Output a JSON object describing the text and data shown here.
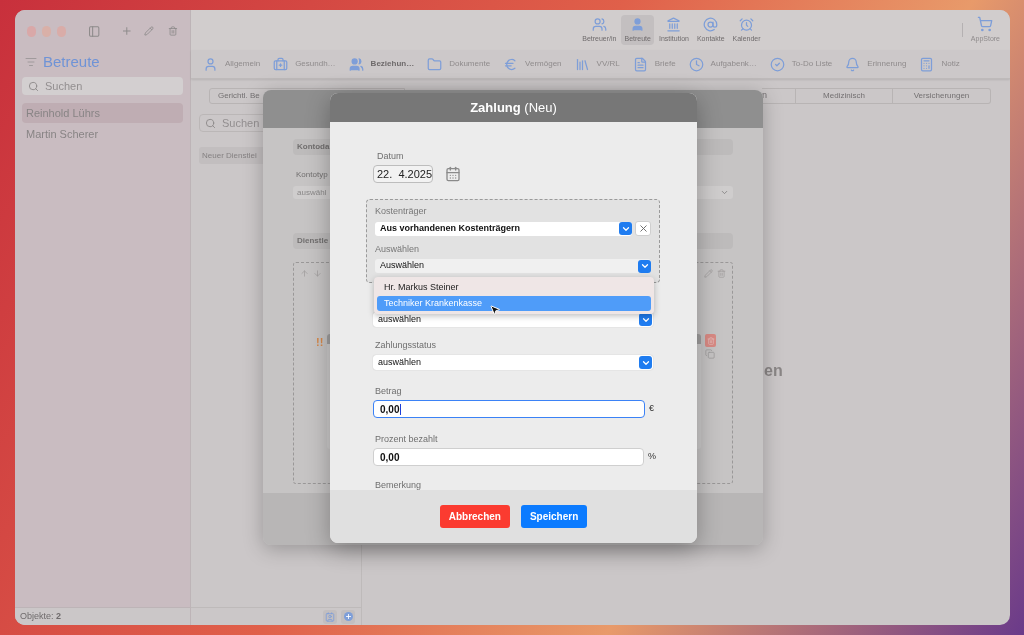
{
  "sidebar": {
    "title": "Betreute",
    "search": {
      "placeholder": "Suchen"
    },
    "items": [
      {
        "label": "Reinhold Lührs",
        "selected": true
      },
      {
        "label": "Martin Scherer",
        "selected": false
      }
    ],
    "status": {
      "label": "Objekte:",
      "count": "2"
    }
  },
  "toolbar": {
    "items": [
      {
        "kind": "caregiver",
        "label": "Betreuer/in",
        "selected": false
      },
      {
        "kind": "person",
        "label": "Betreute",
        "selected": true
      },
      {
        "kind": "institution",
        "label": "Institution",
        "selected": false
      },
      {
        "kind": "contacts",
        "label": "Kontakte",
        "selected": false
      },
      {
        "kind": "calendar",
        "label": "Kalender",
        "selected": false
      }
    ],
    "store": {
      "label": "AppStore"
    }
  },
  "tabs": [
    {
      "kind": "person",
      "label": "Allgemein",
      "selected": false
    },
    {
      "kind": "health",
      "label": "Gesundh…",
      "selected": false
    },
    {
      "kind": "relations",
      "label": "Beziehun…",
      "selected": true
    },
    {
      "kind": "folder",
      "label": "Dokumente",
      "selected": false
    },
    {
      "kind": "money",
      "label": "Vermögen",
      "selected": false
    },
    {
      "kind": "books",
      "label": "VV/RL",
      "selected": false
    },
    {
      "kind": "letter",
      "label": "Briefe",
      "selected": false
    },
    {
      "kind": "tasks",
      "label": "Aufgabenk…",
      "selected": false
    },
    {
      "kind": "todo",
      "label": "To-Do Liste",
      "selected": false
    },
    {
      "kind": "bell",
      "label": "Erinnerung",
      "selected": false
    },
    {
      "kind": "note",
      "label": "Notiz",
      "selected": false
    }
  ],
  "segments": [
    {
      "label": "Gerichtl. Be"
    },
    {
      "label": "n"
    },
    {
      "label": "Medizinisch"
    },
    {
      "label": "Versicherungen"
    }
  ],
  "list": {
    "search": {
      "placeholder": "Suchen"
    },
    "items": [
      {
        "label": "Neuer Dienstlei"
      }
    ]
  },
  "detail": {
    "heading": "en"
  },
  "sheet": {
    "section_1": "Kontoda",
    "field_label": "Kontotyp",
    "field_value": "auswähl",
    "section_2": "Dienstle",
    "warning": "!!"
  },
  "dialog": {
    "title": "Zahlung",
    "subtitle": "(Neu)",
    "date": {
      "label": "Datum",
      "value": "22.  4.2025"
    },
    "payer": {
      "label": "Kostenträger",
      "value": "Aus vorhandenen Kostenträgern",
      "sub_label": "Auswählen",
      "sub_value": "Auswählen"
    },
    "options": [
      {
        "label": "Hr. Markus Steiner",
        "selected": false
      },
      {
        "label": "Techniker Krankenkasse",
        "selected": true
      }
    ],
    "fields": [
      {
        "kind": "select",
        "value": "auswählen"
      },
      {
        "kind": "select",
        "label": "Zahlungsstatus",
        "value": "auswählen"
      },
      {
        "kind": "input",
        "label": "Betrag",
        "value": "0,00",
        "unit": "€",
        "focused": true
      },
      {
        "kind": "input",
        "label": "Prozent bezahlt",
        "value": "0,00",
        "unit": "%",
        "focused": false
      },
      {
        "kind": "label",
        "label": "Bemerkung"
      }
    ],
    "buttons": [
      {
        "kind": "cancel",
        "label": "Abbrechen"
      },
      {
        "kind": "save",
        "label": "Speichern"
      }
    ]
  }
}
